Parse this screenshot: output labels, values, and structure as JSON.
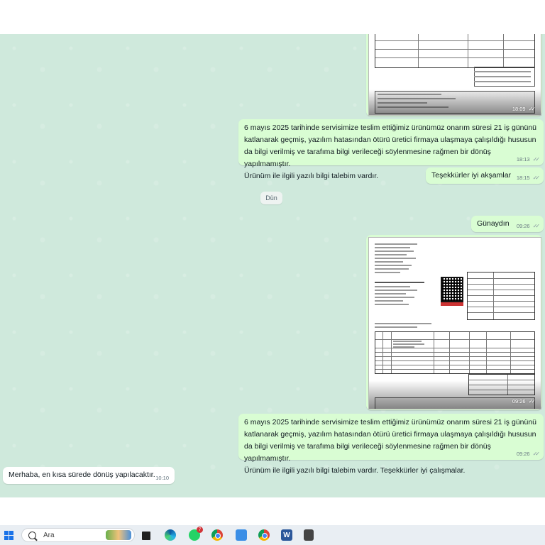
{
  "chat": {
    "messages": [
      {
        "id": "img1",
        "type": "image",
        "time": "18:09"
      },
      {
        "id": "m1",
        "type": "text",
        "direction": "out",
        "lines": [
          "6 mayıs 2025  tarihinde servisimize teslim ettiğimiz ürünümüz  onarım süresi 21 iş gününü",
          "katlanarak geçmiş, yazılım hatasından ötürü üretici firmaya ulaşmaya çalışıldığı hususun",
          "da bilgi verilmiş ve tarafıma bilgi verileceği söylenmesine rağmen bir dönüş yapılmamıştır.",
          "Ürünüm ile ilgili yazılı bilgi talebim vardır."
        ],
        "time": "18:13"
      },
      {
        "id": "m2",
        "type": "text",
        "direction": "out",
        "text": "Teşekkürler iyi akşamlar",
        "time": "18:15"
      },
      {
        "id": "m3",
        "type": "text",
        "direction": "out",
        "text": "Günaydın",
        "time": "09:26"
      },
      {
        "id": "img2",
        "type": "image",
        "time": "09:26"
      },
      {
        "id": "m4",
        "type": "text",
        "direction": "out",
        "lines": [
          "6 mayıs 2025  tarihinde servisimize teslim ettiğimiz ürünümüz  onarım süresi 21 iş gününü",
          "katlanarak geçmiş, yazılım hatasından ötürü üretici firmaya ulaşmaya çalışıldığı hususun",
          "da bilgi verilmiş ve tarafıma bilgi verileceği söylenmesine rağmen bir dönüş yapılmamıştır.",
          "Ürünüm ile ilgili yazılı bilgi talebim vardır. Teşekkürler iyi çalışmalar."
        ],
        "time": "09:26"
      },
      {
        "id": "m5",
        "type": "text",
        "direction": "in",
        "text": "Merhaba, en kısa sürede dönüş yapılacaktır.",
        "time": "10:10"
      }
    ],
    "date_separator": "Dün"
  },
  "taskbar": {
    "search_placeholder": "Ara",
    "whatsapp_badge": "7",
    "icons": [
      "start-icon",
      "search-icon",
      "widgets-icon",
      "task-view-icon",
      "edge-icon",
      "whatsapp-icon",
      "chrome-icon",
      "notepad-icon",
      "chrome-profile-icon",
      "word-icon",
      "calculator-icon"
    ]
  },
  "colors": {
    "chat_bg": "#cfe9dc",
    "outgoing_bubble": "#d9fdd3",
    "incoming_bubble": "#ffffff",
    "taskbar_bg": "#e9eef3"
  }
}
